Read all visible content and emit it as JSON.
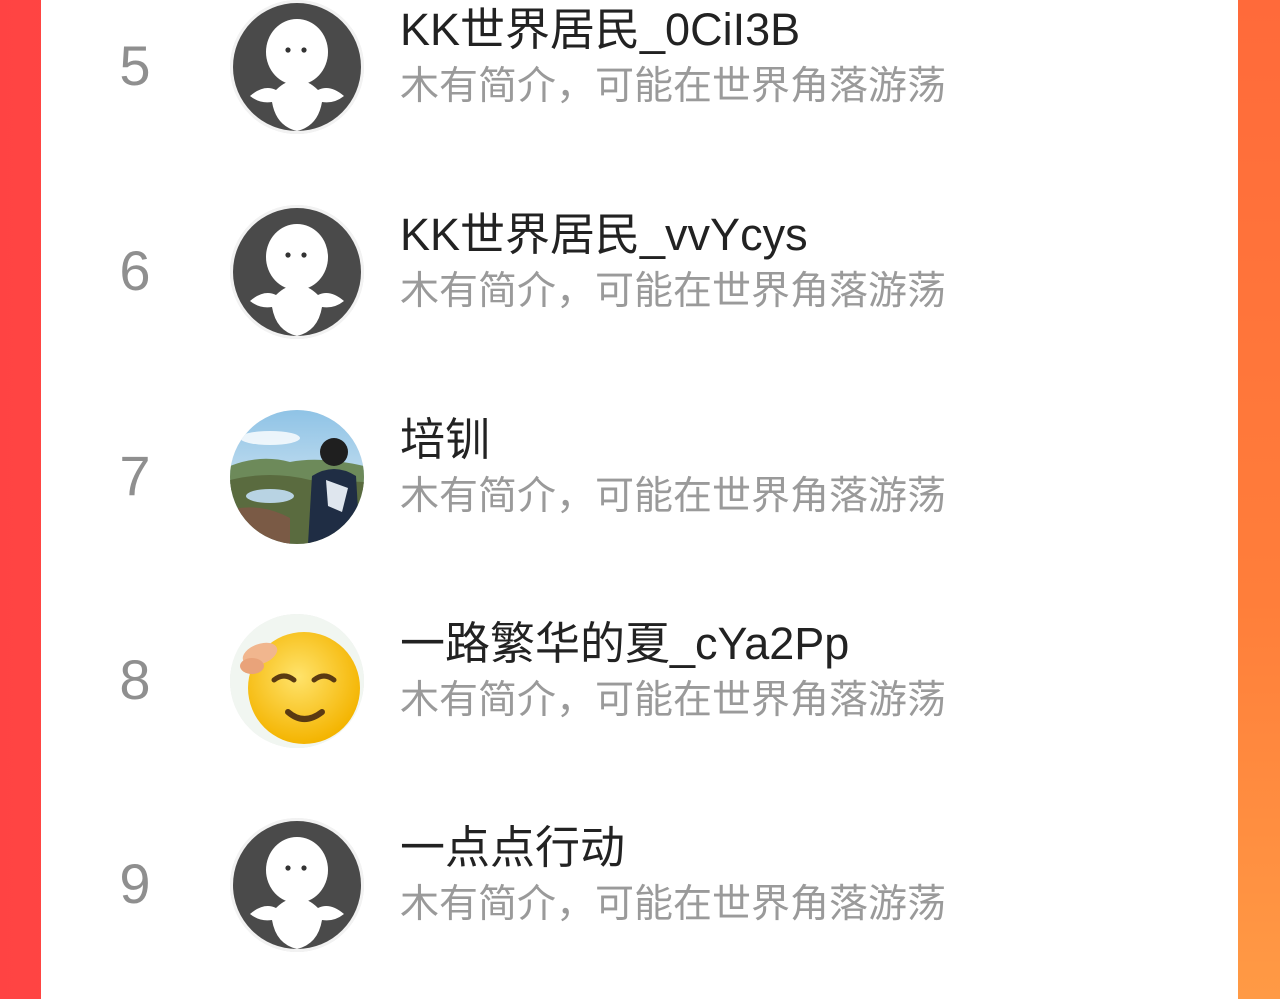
{
  "ranking": {
    "items": [
      {
        "rank": "5",
        "name": "KK世界居民_0CiI3B",
        "bio": "木有简介，可能在世界角落游荡",
        "avatar": "default-avatar-icon"
      },
      {
        "rank": "6",
        "name": "KK世界居民_vvYcys",
        "bio": "木有简介，可能在世界角落游荡",
        "avatar": "default-avatar-icon"
      },
      {
        "rank": "7",
        "name": "培钏",
        "bio": "木有简介，可能在世界角落游荡",
        "avatar": "landscape-photo-avatar"
      },
      {
        "rank": "8",
        "name": "一路繁华的夏_cYa2Pp",
        "bio": "木有简介，可能在世界角落游荡",
        "avatar": "relieved-emoji-avatar"
      },
      {
        "rank": "9",
        "name": "一点点行动",
        "bio": "木有简介，可能在世界角落游荡",
        "avatar": "default-avatar-icon"
      }
    ]
  },
  "colors": {
    "background_left": "#ff4343",
    "background_right": "#ff7a3c",
    "rank_text": "#8f8f8f",
    "name_text": "#222222",
    "bio_text": "#9a9a9a"
  }
}
